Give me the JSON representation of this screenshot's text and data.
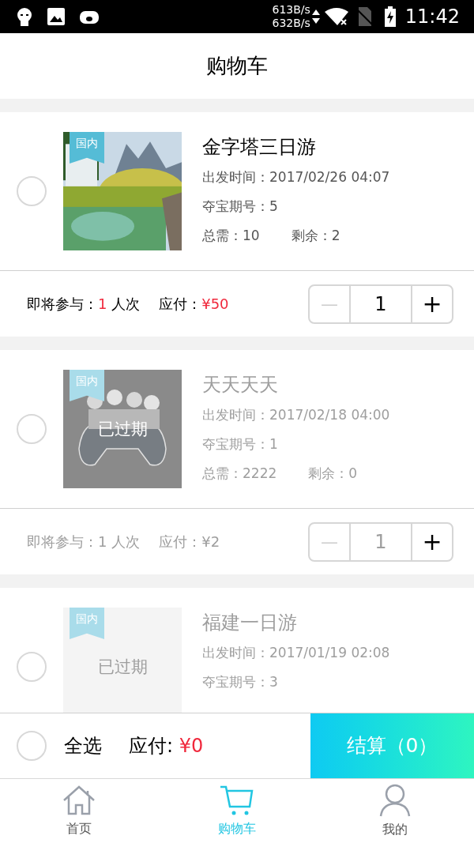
{
  "status_bar": {
    "net_up": "613B/s",
    "net_down": "632B/s",
    "time": "11:42"
  },
  "header": {
    "title": "购物车"
  },
  "cart_items": [
    {
      "tag": "国内",
      "expired": false,
      "selected": false,
      "name": "金字塔三日游",
      "departure": "出发时间：2017/02/26 04:07",
      "period": "夺宝期号：5",
      "total": "总需：10",
      "remaining": "剩余：2",
      "participate_label": "即将参与：",
      "participate_count": "1",
      "participate_unit": "人次",
      "pay_label": "应付：",
      "pay_amount": "¥50",
      "quantity": "1",
      "minus": "—",
      "plus": "+",
      "minus_disabled": true
    },
    {
      "tag": "国内",
      "expired": true,
      "expired_label": "已过期",
      "selected": false,
      "name": "天天天天",
      "departure": "出发时间：2017/02/18 04:00",
      "period": "夺宝期号：1",
      "total": "总需：2222",
      "remaining": "剩余：0",
      "participate_label": "即将参与：",
      "participate_count": "1",
      "participate_unit": "人次",
      "pay_label": "应付：",
      "pay_amount": "¥2",
      "quantity": "1",
      "minus": "—",
      "plus": "+",
      "minus_disabled": true
    },
    {
      "tag": "国内",
      "image": {
        "kind": "blank"
      },
      "expired": true,
      "expired_label": "已过期",
      "selected": false,
      "name": "福建一日游",
      "departure": "出发时间：2017/01/19 02:08",
      "period": "夺宝期号：3"
    }
  ],
  "checkout_bar": {
    "select_all": {
      "label": "全选",
      "selected": false
    },
    "pay_label": "应付:",
    "pay_amount": "¥0",
    "checkout_button": "结算（0）"
  },
  "tab_bar": [
    {
      "label": "首页",
      "selected": false
    },
    {
      "label": "购物车",
      "selected": true
    },
    {
      "label": "我的",
      "selected": false
    }
  ]
}
